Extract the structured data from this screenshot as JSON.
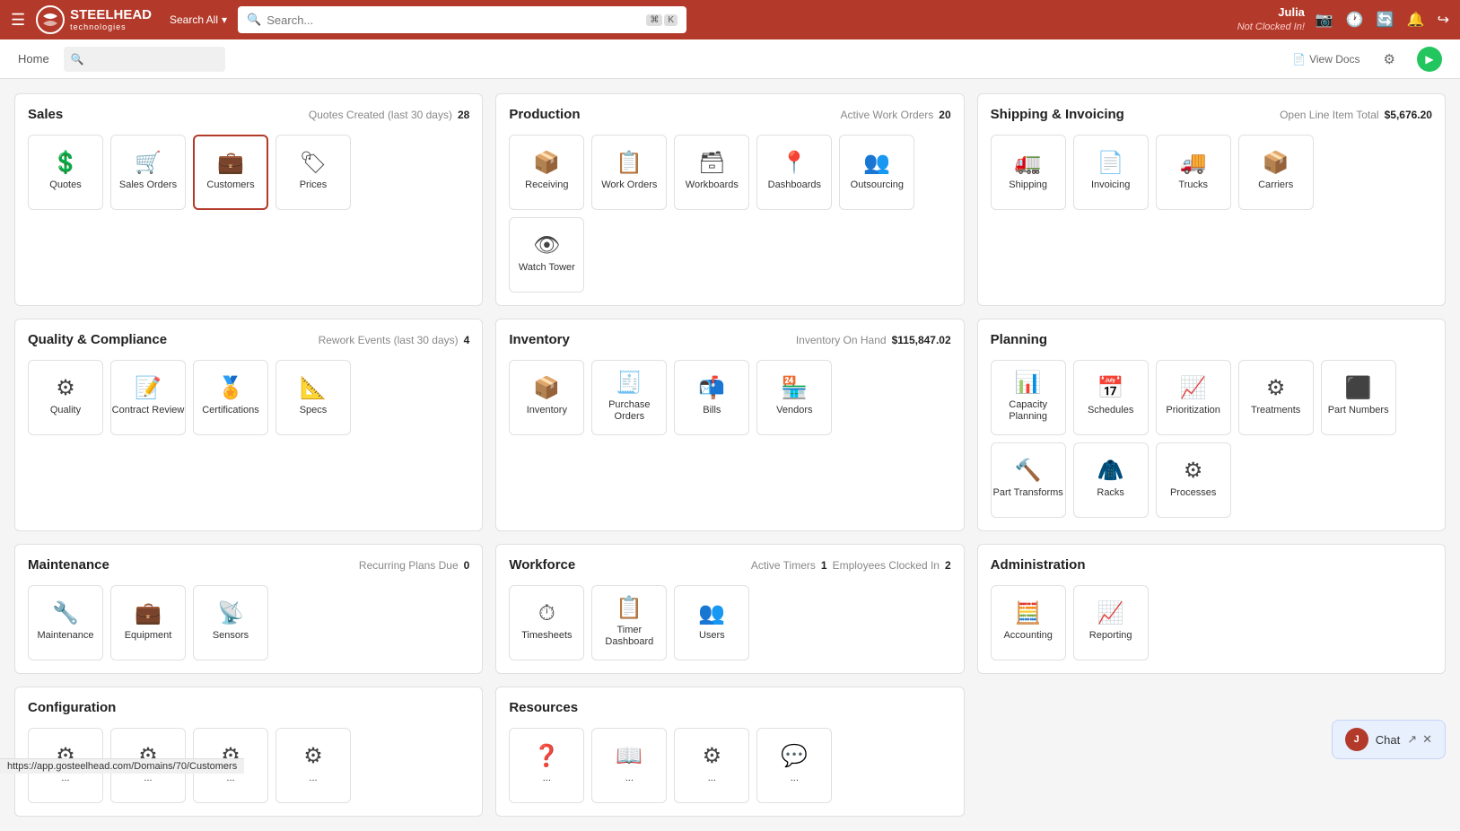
{
  "topnav": {
    "hamburger": "☰",
    "logo_text": "STEELHEAD",
    "logo_sub": "technologies",
    "search_all_label": "Search All",
    "search_placeholder": "Search...",
    "kbd1": "⌘",
    "kbd2": "K",
    "user_name": "Julia",
    "user_status": "Not Clocked In!",
    "view_docs": "View Docs"
  },
  "breadcrumb": {
    "home": "Home"
  },
  "sections": [
    {
      "id": "sales",
      "title": "Sales",
      "stat_label": "Quotes Created (last 30 days)",
      "stat_value": "28",
      "modules": [
        {
          "label": "Quotes",
          "icon": "💲",
          "active": false
        },
        {
          "label": "Sales Orders",
          "icon": "🛒",
          "active": false
        },
        {
          "label": "Customers",
          "icon": "💼",
          "active": true
        },
        {
          "label": "Prices",
          "icon": "🏷",
          "active": false
        }
      ]
    },
    {
      "id": "production",
      "title": "Production",
      "stat_label": "Active Work Orders",
      "stat_value": "20",
      "modules": [
        {
          "label": "Receiving",
          "icon": "📦",
          "active": false
        },
        {
          "label": "Work Orders",
          "icon": "📋",
          "active": false
        },
        {
          "label": "Workboards",
          "icon": "🗃",
          "active": false
        },
        {
          "label": "Dashboards",
          "icon": "📍",
          "active": false
        },
        {
          "label": "Outsourcing",
          "icon": "👥",
          "active": false
        },
        {
          "label": "Watch Tower",
          "icon": "👁",
          "active": false
        }
      ]
    },
    {
      "id": "shipping",
      "title": "Shipping & Invoicing",
      "stat_label": "Open Line Item Total",
      "stat_value": "$5,676.20",
      "modules": [
        {
          "label": "Shipping",
          "icon": "🚛",
          "active": false
        },
        {
          "label": "Invoicing",
          "icon": "📄",
          "active": false
        },
        {
          "label": "Trucks",
          "icon": "🚚",
          "active": false
        },
        {
          "label": "Carriers",
          "icon": "📦",
          "active": false
        }
      ]
    },
    {
      "id": "quality",
      "title": "Quality & Compliance",
      "stat_label": "Rework Events (last 30 days)",
      "stat_value": "4",
      "modules": [
        {
          "label": "Quality",
          "icon": "⚙",
          "active": false
        },
        {
          "label": "Contract Review",
          "icon": "📝",
          "active": false
        },
        {
          "label": "Certifications",
          "icon": "🏅",
          "active": false
        },
        {
          "label": "Specs",
          "icon": "📐",
          "active": false
        }
      ]
    },
    {
      "id": "inventory",
      "title": "Inventory",
      "stat_label": "Inventory On Hand",
      "stat_value": "$115,847.02",
      "modules": [
        {
          "label": "Inventory",
          "icon": "📦",
          "active": false
        },
        {
          "label": "Purchase Orders",
          "icon": "🧾",
          "active": false
        },
        {
          "label": "Bills",
          "icon": "📬",
          "active": false
        },
        {
          "label": "Vendors",
          "icon": "🏪",
          "active": false
        }
      ]
    },
    {
      "id": "planning",
      "title": "Planning",
      "stat_label": "",
      "stat_value": "",
      "modules": [
        {
          "label": "Capacity Planning",
          "icon": "🔽",
          "active": false
        },
        {
          "label": "Schedules",
          "icon": "📅",
          "active": false
        },
        {
          "label": "Prioritization",
          "icon": "📊",
          "active": false
        },
        {
          "label": "Treatments",
          "icon": "⚙",
          "active": false
        },
        {
          "label": "Part Numbers",
          "icon": "⬛",
          "active": false
        },
        {
          "label": "Part Transforms",
          "icon": "🔨",
          "active": false
        },
        {
          "label": "Racks",
          "icon": "🧥",
          "active": false
        },
        {
          "label": "Processes",
          "icon": "⚙",
          "active": false
        }
      ]
    },
    {
      "id": "maintenance",
      "title": "Maintenance",
      "stat_label": "Recurring Plans Due",
      "stat_value": "0",
      "modules": [
        {
          "label": "Maintenance",
          "icon": "🔧",
          "active": false
        },
        {
          "label": "Equipment",
          "icon": "💼",
          "active": false
        },
        {
          "label": "Sensors",
          "icon": "📡",
          "active": false
        }
      ]
    },
    {
      "id": "workforce",
      "title": "Workforce",
      "stat_label_1": "Active Timers",
      "stat_value_1": "1",
      "stat_label_2": "Employees Clocked In",
      "stat_value_2": "2",
      "modules": [
        {
          "label": "Timesheets",
          "icon": "⏱",
          "active": false
        },
        {
          "label": "Timer Dashboard",
          "icon": "📋",
          "active": false
        },
        {
          "label": "Users",
          "icon": "👥",
          "active": false
        }
      ]
    },
    {
      "id": "administration",
      "title": "Administration",
      "stat_label": "",
      "stat_value": "",
      "modules": [
        {
          "label": "Accounting",
          "icon": "🧮",
          "active": false
        },
        {
          "label": "Reporting",
          "icon": "📈",
          "active": false
        }
      ]
    },
    {
      "id": "configuration",
      "title": "Configuration",
      "stat_label": "",
      "stat_value": "",
      "modules": [
        {
          "label": "...",
          "icon": "⚙",
          "active": false
        },
        {
          "label": "...",
          "icon": "⚙",
          "active": false
        },
        {
          "label": "...",
          "icon": "⚙",
          "active": false
        },
        {
          "label": "...",
          "icon": "⚙",
          "active": false
        }
      ]
    },
    {
      "id": "resources",
      "title": "Resources",
      "stat_label": "",
      "stat_value": "",
      "modules": [
        {
          "label": "...",
          "icon": "❓",
          "active": false
        },
        {
          "label": "...",
          "icon": "📖",
          "active": false
        },
        {
          "label": "...",
          "icon": "⚙",
          "active": false
        },
        {
          "label": "...",
          "icon": "💬",
          "active": false
        }
      ]
    }
  ],
  "chat": {
    "avatar": "J",
    "label": "Chat"
  },
  "url": "https://app.gosteelhead.com/Domains/70/Customers"
}
